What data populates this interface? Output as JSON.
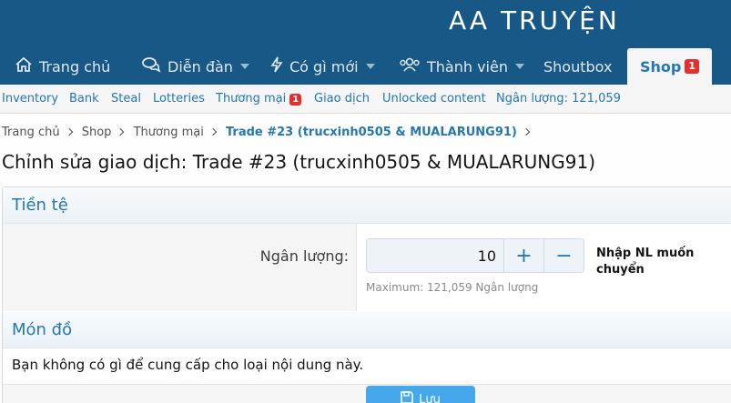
{
  "site": {
    "logo": "AA TRUYỆN"
  },
  "nav": {
    "items": [
      {
        "label": "Trang chủ",
        "icon": "home-icon"
      },
      {
        "label": "Diễn đàn",
        "icon": "comments-icon"
      },
      {
        "label": "Có gì mới",
        "icon": "bolt-icon"
      },
      {
        "label": "Thành viên",
        "icon": "users-icon"
      },
      {
        "label": "Shoutbox"
      },
      {
        "label": "Shop",
        "badge": "1"
      }
    ]
  },
  "subnav": {
    "items": [
      {
        "label": "Inventory"
      },
      {
        "label": "Bank"
      },
      {
        "label": "Steal"
      },
      {
        "label": "Lotteries"
      },
      {
        "label": "Thương mại",
        "badge": "1"
      },
      {
        "label": "Giao dịch"
      },
      {
        "label": "Unlocked content"
      },
      {
        "label": "Ngân lượng: 121,059"
      }
    ]
  },
  "breadcrumb": [
    "Trang chủ",
    "Shop",
    "Thương mại",
    "Trade #23 (trucxinh0505 & MUALARUNG91)"
  ],
  "page": {
    "title": "Chỉnh sửa giao dịch: Trade #23 (trucxinh0505 & MUALARUNG91)"
  },
  "currency": {
    "section_title": "Tiền tệ",
    "field_label": "Ngân lượng:",
    "value": "10",
    "plus": "+",
    "minus": "−",
    "hint": "Nhập NL muốn chuyển",
    "explain": "Maximum: 121,059 Ngân lượng"
  },
  "items": {
    "section_title": "Món đồ",
    "empty_message": "Bạn không có gì để cung cấp cho loại nội dung này."
  },
  "actions": {
    "save_label": "Lưu"
  },
  "colors": {
    "header": "#185886",
    "link": "#2577b1",
    "badge": "#e03030",
    "button": "#47a7eb"
  }
}
